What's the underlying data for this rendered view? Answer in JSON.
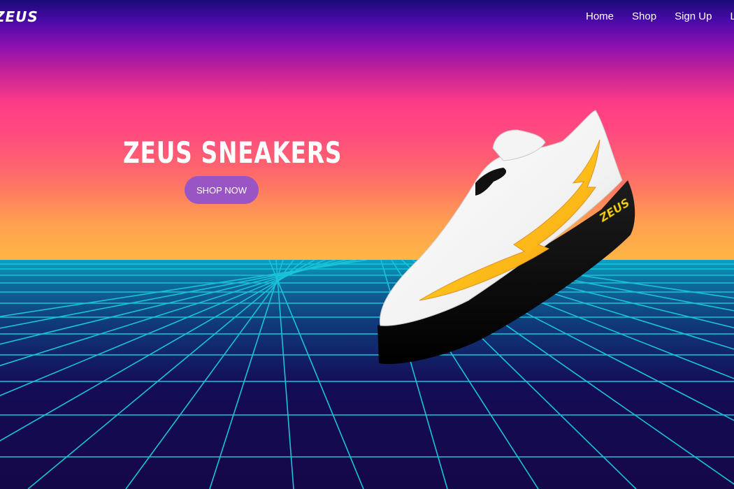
{
  "brand": {
    "logo_text": "ZEUS"
  },
  "nav": {
    "items": [
      {
        "label": "Home"
      },
      {
        "label": "Shop"
      },
      {
        "label": "Sign Up"
      },
      {
        "label": "Lo"
      }
    ]
  },
  "hero": {
    "title": "ZEUS SNEAKERS",
    "cta_label": "SHOP NOW"
  },
  "product": {
    "sole_logo_text": "ZEUS"
  },
  "colors": {
    "cta": "#9a55c4",
    "grid_line": "#19c3d8",
    "floor": "#150848",
    "sky_top": "#1a0a7a",
    "sky_bottom": "#ffb544"
  }
}
